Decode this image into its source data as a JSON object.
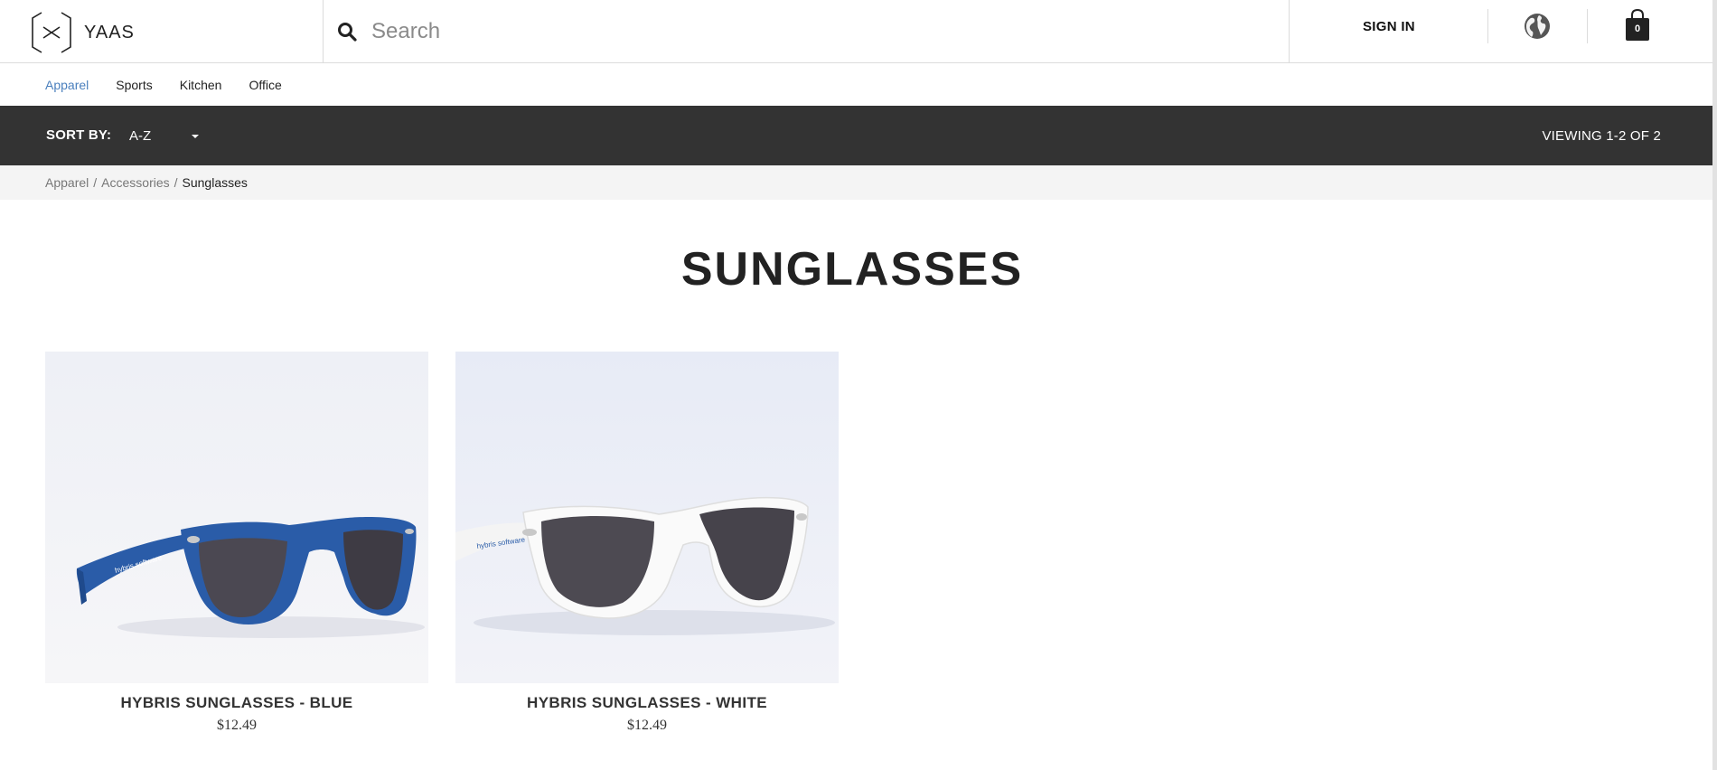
{
  "header": {
    "logo_text": "YAAS",
    "search_placeholder": "Search",
    "signin_label": "SIGN IN",
    "cart_count": "0"
  },
  "category_nav": [
    {
      "label": "Apparel",
      "active": true
    },
    {
      "label": "Sports",
      "active": false
    },
    {
      "label": "Kitchen",
      "active": false
    },
    {
      "label": "Office",
      "active": false
    }
  ],
  "sortbar": {
    "label": "SORT BY:",
    "value": "A-Z",
    "viewing": "VIEWING 1-2 OF 2"
  },
  "breadcrumb": {
    "items": [
      "Apparel",
      "Accessories"
    ],
    "separator": "/",
    "current": "Sunglasses"
  },
  "page_title": "SUNGLASSES",
  "products": [
    {
      "name": "HYBRIS SUNGLASSES - BLUE",
      "price": "$12.49",
      "frame_color": "#2a5ca8"
    },
    {
      "name": "HYBRIS SUNGLASSES - WHITE",
      "price": "$12.49",
      "frame_color": "#f7f7f7"
    }
  ],
  "colors": {
    "active_link": "#4a7fbd",
    "sortbar_bg": "#333333",
    "breadcrumb_bg": "#f4f4f4"
  }
}
